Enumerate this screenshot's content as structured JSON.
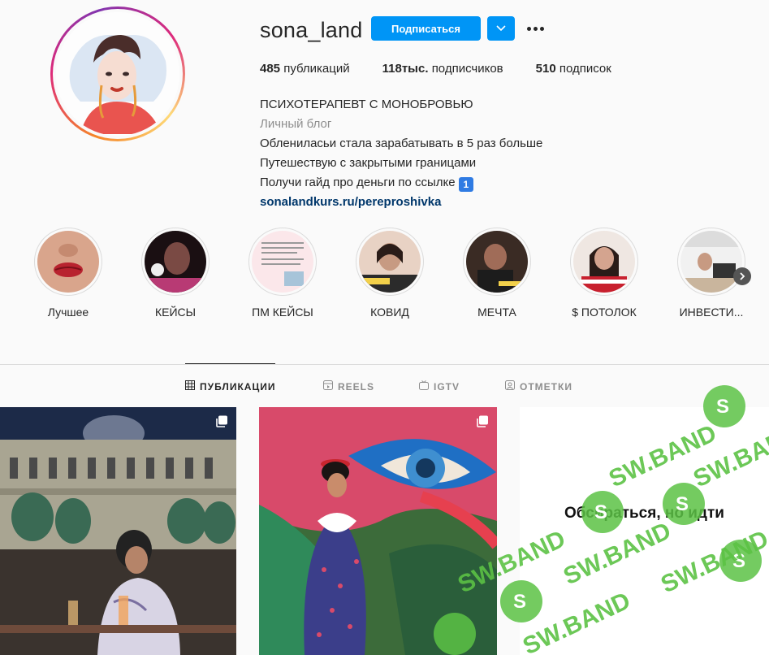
{
  "profile": {
    "username": "sona_land",
    "follow_label": "Подписаться",
    "stats": [
      {
        "count": "485",
        "label": "публикаций"
      },
      {
        "count": "118тыс.",
        "label": "подписчиков"
      },
      {
        "count": "510",
        "label": "подписок"
      }
    ],
    "bio": {
      "name": "ПСИХОТЕРАПЕВТ С МОНОБРОВЬЮ",
      "category": "Личный блог",
      "lines": [
        "Облениласьи стала зарабатывать в 5 раз больше",
        "Путешествую с закрытыми границами",
        "Получи гайд про деньги по ссылке"
      ],
      "emoji": "1",
      "link": "sonalandkurs.ru/pereproshivka"
    }
  },
  "highlights": [
    {
      "label": "Лучшее"
    },
    {
      "label": "КЕЙСЫ"
    },
    {
      "label": "ПМ КЕЙСЫ"
    },
    {
      "label": "КОВИД"
    },
    {
      "label": "МЕЧТА"
    },
    {
      "label": "$ ПОТОЛОК"
    },
    {
      "label": "ИНВЕСТИ..."
    }
  ],
  "tabs": [
    {
      "label": "ПУБЛИКАЦИИ",
      "icon": "grid-icon",
      "active": true
    },
    {
      "label": "REELS",
      "icon": "reels-icon",
      "active": false
    },
    {
      "label": "IGTV",
      "icon": "igtv-icon",
      "active": false
    },
    {
      "label": "ОТМЕТКИ",
      "icon": "tagged-icon",
      "active": false
    }
  ],
  "posts": [
    {
      "kind": "photo",
      "multi": true
    },
    {
      "kind": "photo",
      "multi": true
    },
    {
      "kind": "text",
      "text": "Обсираться, но идти"
    }
  ],
  "colors": {
    "accent": "#0095f6",
    "link": "#00376b",
    "muted": "#8e8e8e",
    "watermark": "#5cc245"
  },
  "watermark": {
    "text": "SW.BAND"
  }
}
